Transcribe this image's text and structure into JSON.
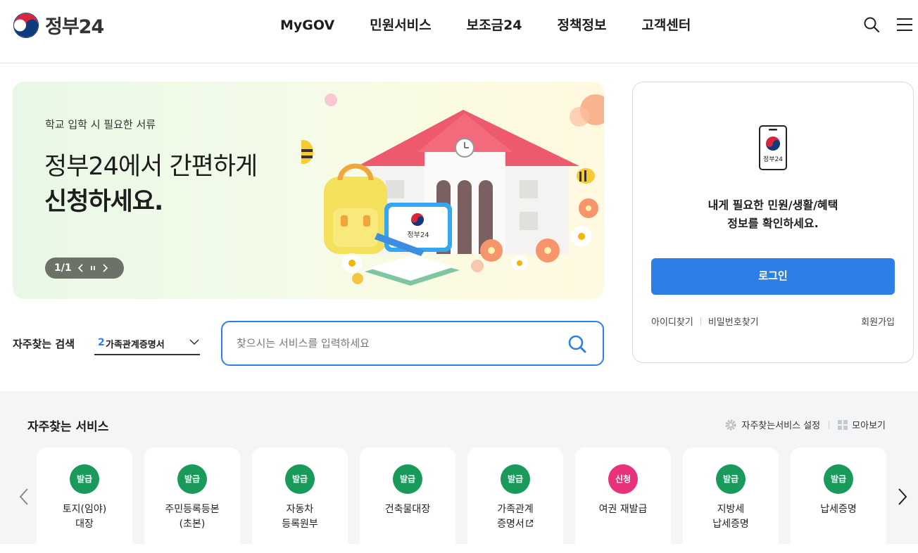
{
  "header": {
    "logo_text": "정부24",
    "nav": [
      "MyGOV",
      "민원서비스",
      "보조금24",
      "정책정보",
      "고객센터"
    ]
  },
  "banner": {
    "subtitle": "학교 입학 시 필요한 서류",
    "title_line1": "정부24에서 간편하게",
    "title_line2": "신청하세요.",
    "pager": "1/1",
    "illustration_label": "정부24"
  },
  "login": {
    "phone_label": "정부24",
    "message_line1": "내게 필요한 민원/생활/혜택",
    "message_line2": "정보를 확인하세요.",
    "button": "로그인",
    "find_id": "아이디찾기",
    "find_pw": "비밀번호찾기",
    "join": "회원가입"
  },
  "search": {
    "freq_label": "자주찾는 검색",
    "selected_rank": "2",
    "selected_text": "가족관계증명서",
    "placeholder": "찾으시는 서비스를 입력하세요"
  },
  "services": {
    "title": "자주찾는 서비스",
    "settings": "자주찾는서비스 설정",
    "view_all": "모아보기",
    "items": [
      {
        "badge": "발급",
        "label": "토지(임야)\n대장",
        "color": "green"
      },
      {
        "badge": "발급",
        "label": "주민등록등본\n(초본)",
        "color": "green"
      },
      {
        "badge": "발급",
        "label": "자동차\n등록원부",
        "color": "green"
      },
      {
        "badge": "발급",
        "label": "건축물대장",
        "color": "green"
      },
      {
        "badge": "발급",
        "label": "가족관계\n증명서",
        "color": "green"
      },
      {
        "badge": "신청",
        "label": "여권 재발급",
        "color": "pink"
      },
      {
        "badge": "발급",
        "label": "지방세\n납세증명",
        "color": "green"
      },
      {
        "badge": "발급",
        "label": "납세증명",
        "color": "green"
      }
    ]
  },
  "colors": {
    "primary_blue": "#2d7fe6",
    "badge_green": "#1a9a5a",
    "badge_pink": "#e8337a"
  }
}
